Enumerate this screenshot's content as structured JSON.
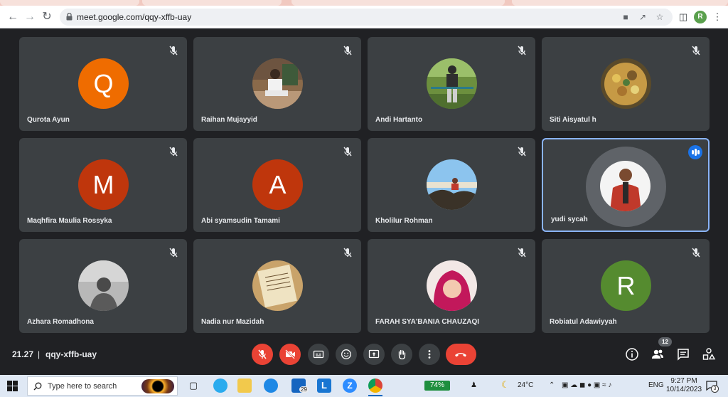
{
  "browser": {
    "url": "meet.google.com/qqy-xffb-uay",
    "profile_initial": "R"
  },
  "participants": [
    {
      "name": "Qurota Ayun",
      "avatar_letter": "Q",
      "avatar_color": "#ef6c00",
      "muted": true
    },
    {
      "name": "Raihan Mujayyid",
      "photo": true,
      "muted": true
    },
    {
      "name": "Andi Hartanto",
      "photo": true,
      "muted": true
    },
    {
      "name": "Siti Aisyatul h",
      "photo": true,
      "muted": true
    },
    {
      "name": "Maqhfira Maulia Rossyka",
      "avatar_letter": "M",
      "avatar_color": "#bf360c",
      "muted": true
    },
    {
      "name": "Abi syamsudin Tamami",
      "avatar_letter": "A",
      "avatar_color": "#bf360c",
      "muted": true
    },
    {
      "name": "Kholilur Rohman",
      "photo": true,
      "muted": true
    },
    {
      "name": "yudi sycah",
      "photo": true,
      "muted": false,
      "speaking": true
    },
    {
      "name": "Azhara Romadhona",
      "photo": true,
      "muted": true
    },
    {
      "name": "Nadia nur Mazidah",
      "photo": true,
      "muted": true
    },
    {
      "name": "FARAH SYA'BANIA CHAUZAQI",
      "photo": true,
      "muted": true
    },
    {
      "name": "Robiatul Adawiyyah",
      "avatar_letter": "R",
      "avatar_color": "#558b2f",
      "muted": true
    }
  ],
  "meeting": {
    "time": "21.27",
    "separator": "|",
    "code": "qqy-xffb-uay",
    "participant_count": "12"
  },
  "controls": [
    "mic-off",
    "camera-off",
    "captions",
    "emoji",
    "present",
    "raise-hand",
    "more-options",
    "leave-call"
  ],
  "side_controls": [
    "meeting-details",
    "people",
    "chat",
    "activities"
  ],
  "taskbar": {
    "search_placeholder": "Type here to search",
    "mail_badge": "29",
    "battery_percent": "74%",
    "weather": "24°C",
    "language": "ENG",
    "time": "9:27 PM",
    "date": "10/14/2023",
    "notification_count": "3"
  },
  "colors": {
    "meet_bg": "#202124",
    "tile_bg": "#3c4043",
    "danger": "#ea4335",
    "active_border": "#8ab4f8"
  }
}
